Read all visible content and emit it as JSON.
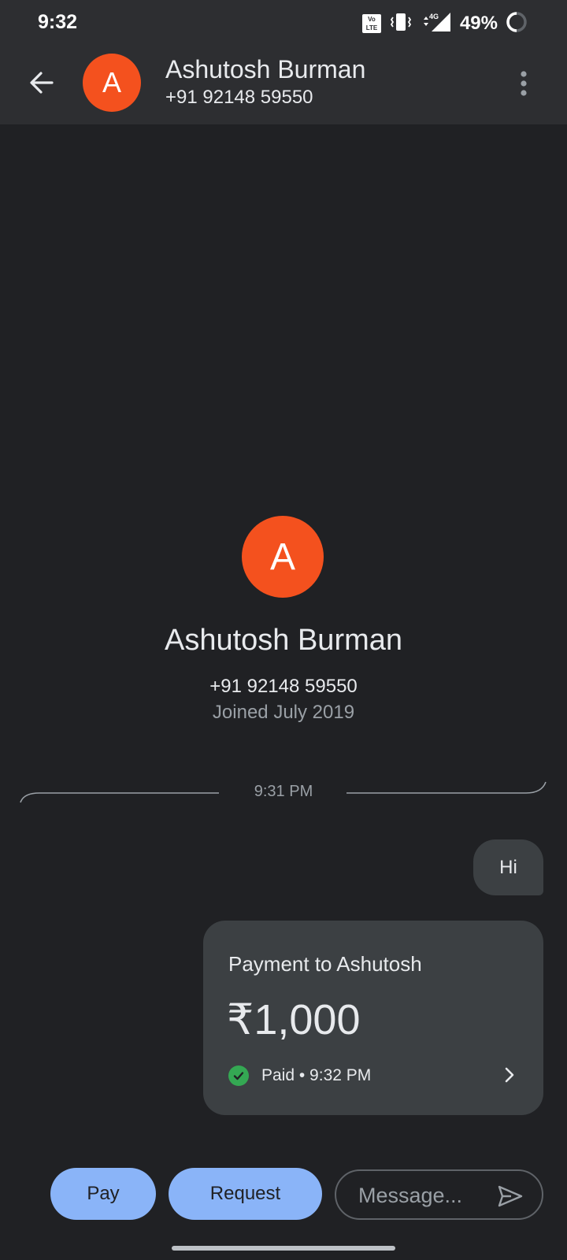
{
  "status_bar": {
    "time": "9:32",
    "volte_badge": "Vo LTE",
    "network_label": "4G",
    "battery_percent": "49%",
    "icons": [
      "volte-icon",
      "vibrate-icon",
      "signal-4g-icon",
      "battery-ring-icon"
    ]
  },
  "header": {
    "avatar_initial": "A",
    "contact_name": "Ashutosh Burman",
    "contact_phone": "+91 92148 59550",
    "avatar_color": "#f4511e"
  },
  "profile": {
    "avatar_initial": "A",
    "name": "Ashutosh Burman",
    "phone": "+91 92148 59550",
    "joined": "Joined July 2019"
  },
  "conversation": {
    "divider_time": "9:31 PM",
    "messages": [
      {
        "type": "text",
        "direction": "sent",
        "text": "Hi"
      }
    ],
    "payment": {
      "title": "Payment to Ashutosh",
      "amount": "₹1,000",
      "status": "Paid • 9:32 PM",
      "status_color": "#34a853"
    }
  },
  "composer": {
    "pay_label": "Pay",
    "request_label": "Request",
    "message_placeholder": "Message...",
    "accent_color": "#8ab4f8"
  }
}
